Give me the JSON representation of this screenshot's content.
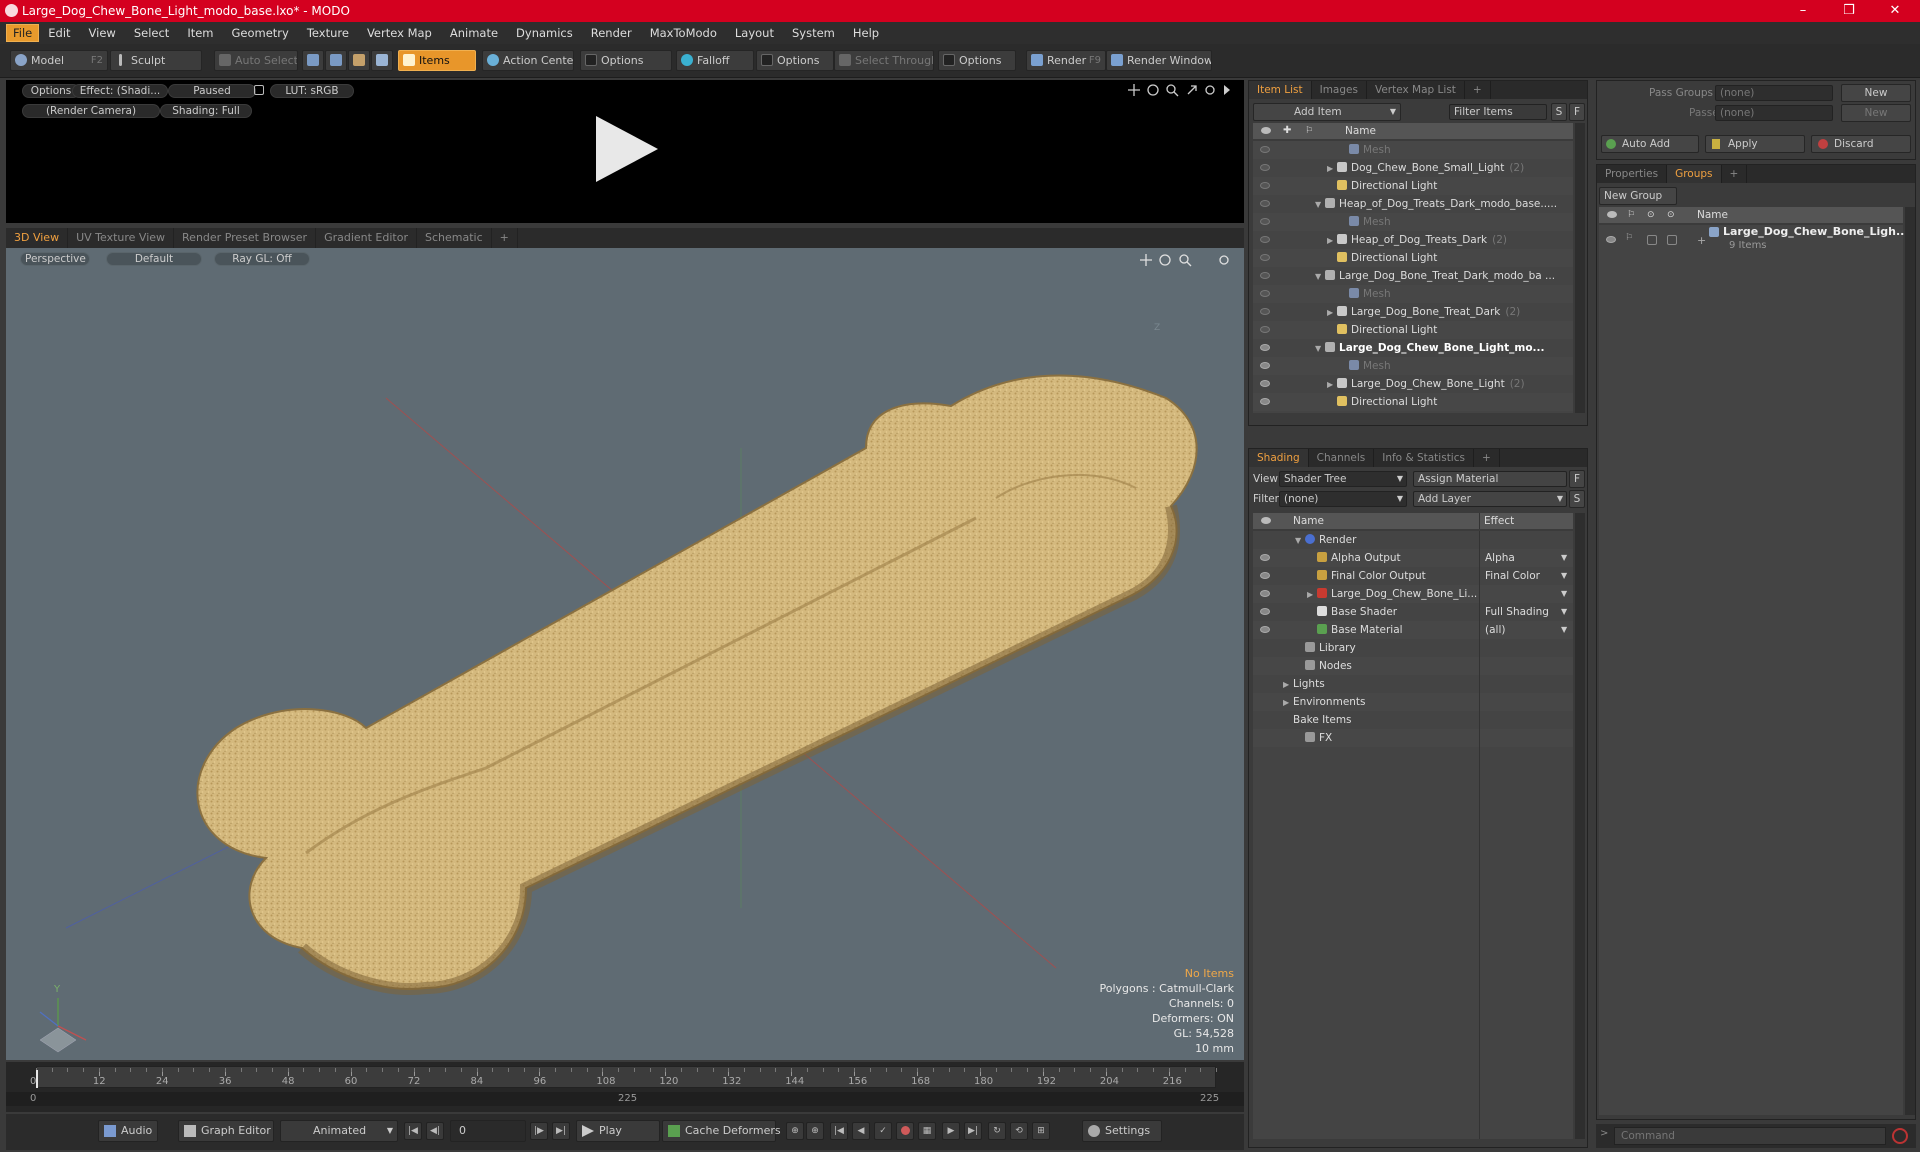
{
  "window": {
    "title": "Large_Dog_Chew_Bone_Light_modo_base.lxo* - MODO",
    "minimize": "–",
    "maximize": "❒",
    "close": "✕"
  },
  "menu": [
    "File",
    "Edit",
    "View",
    "Select",
    "Item",
    "Geometry",
    "Texture",
    "Vertex Map",
    "Animate",
    "Dynamics",
    "Render",
    "MaxToModo",
    "Layout",
    "System",
    "Help"
  ],
  "toolbar": {
    "model": "Model",
    "model_key": "F2",
    "sculpt": "Sculpt",
    "auto_select": "Auto Select",
    "items": "Items",
    "action_center": "Action Center",
    "options1": "Options",
    "falloff": "Falloff",
    "options2": "Options",
    "select_through": "Select Through",
    "options3": "Options",
    "render": "Render",
    "render_key": "F9",
    "render_window": "Render Window"
  },
  "preview": {
    "options": "Options",
    "effect": "Effect: (Shadi...",
    "paused": "Paused",
    "lut": "LUT: sRGB",
    "camera": "(Render Camera)",
    "shading": "Shading: Full"
  },
  "viewport_tabs": [
    "3D View",
    "UV Texture View",
    "Render Preset Browser",
    "Gradient Editor",
    "Schematic",
    "+"
  ],
  "viewport": {
    "perspective": "Perspective",
    "default": "Default",
    "raygl": "Ray GL: Off",
    "axis_z": "Z",
    "axis_y": "Y",
    "axis_x": "X"
  },
  "hud": {
    "items": "No Items",
    "polygons": "Polygons : Catmull-Clark",
    "channels": "Channels: 0",
    "deformers": "Deformers: ON",
    "gl": "GL: 54,528",
    "units": "10 mm"
  },
  "timeline": {
    "ticks": [
      "0",
      "12",
      "24",
      "36",
      "48",
      "60",
      "72",
      "84",
      "96",
      "108",
      "120",
      "132",
      "144",
      "156",
      "168",
      "180",
      "192",
      "204",
      "216"
    ],
    "start": "0",
    "mid": "225",
    "end": "225"
  },
  "bottom": {
    "audio": "Audio",
    "graph_editor": "Graph Editor",
    "animated": "Animated",
    "frame": "0",
    "play": "Play",
    "cache": "Cache Deformers",
    "settings": "Settings"
  },
  "itemlist": {
    "tabs": [
      "Item List",
      "Images",
      "Vertex Map List",
      "+"
    ],
    "add_item": "Add Item",
    "filter": "Filter Items",
    "s": "S",
    "f": "F",
    "col_name": "Name",
    "rows": [
      {
        "label": "Mesh",
        "indent": 3,
        "type": "mesh",
        "expand": "",
        "gray": true,
        "bold": false
      },
      {
        "label": "Dog_Chew_Bone_Small_Light",
        "count": "(2)",
        "indent": 2,
        "type": "group",
        "expand": "▶",
        "gray": false,
        "bold": false
      },
      {
        "label": "Directional Light",
        "indent": 2,
        "type": "light",
        "expand": "",
        "gray": false,
        "bold": false
      },
      {
        "label": "Heap_of_Dog_Treats_Dark_modo_base.....",
        "indent": 1,
        "type": "scene",
        "expand": "▼",
        "gray": false,
        "bold": false
      },
      {
        "label": "Mesh",
        "indent": 3,
        "type": "mesh",
        "expand": "",
        "gray": true,
        "bold": false
      },
      {
        "label": "Heap_of_Dog_Treats_Dark",
        "count": "(2)",
        "indent": 2,
        "type": "group",
        "expand": "▶",
        "gray": false,
        "bold": false
      },
      {
        "label": "Directional Light",
        "indent": 2,
        "type": "light",
        "expand": "",
        "gray": false,
        "bold": false
      },
      {
        "label": "Large_Dog_Bone_Treat_Dark_modo_ba ...",
        "indent": 1,
        "type": "scene",
        "expand": "▼",
        "gray": false,
        "bold": false
      },
      {
        "label": "Mesh",
        "indent": 3,
        "type": "mesh",
        "expand": "",
        "gray": true,
        "bold": false
      },
      {
        "label": "Large_Dog_Bone_Treat_Dark",
        "count": "(2)",
        "indent": 2,
        "type": "group",
        "expand": "▶",
        "gray": false,
        "bold": false
      },
      {
        "label": "Directional Light",
        "indent": 2,
        "type": "light",
        "expand": "",
        "gray": false,
        "bold": false
      },
      {
        "label": "Large_Dog_Chew_Bone_Light_mo...",
        "indent": 1,
        "type": "scene",
        "expand": "▼",
        "gray": false,
        "bold": true
      },
      {
        "label": "Mesh",
        "indent": 3,
        "type": "mesh",
        "expand": "",
        "gray": true,
        "bold": false
      },
      {
        "label": "Large_Dog_Chew_Bone_Light",
        "count": "(2)",
        "indent": 2,
        "type": "group",
        "expand": "▶",
        "gray": false,
        "bold": false
      },
      {
        "label": "Directional Light",
        "indent": 2,
        "type": "light",
        "expand": "",
        "gray": false,
        "bold": false
      }
    ]
  },
  "shading": {
    "tabs": [
      "Shading",
      "Channels",
      "Info & Statistics",
      "+"
    ],
    "view_label": "View",
    "view_value": "Shader Tree",
    "assign": "Assign Material",
    "f": "F",
    "filter_label": "Filter",
    "filter_value": "(none)",
    "add_layer": "Add Layer",
    "s": "S",
    "col_name": "Name",
    "col_effect": "Effect",
    "rows": [
      {
        "label": "Render",
        "effect": "",
        "indent": 1,
        "expand": "▼",
        "icon": "#4a6fd0",
        "eye": false,
        "dd": false
      },
      {
        "label": "Alpha Output",
        "effect": "Alpha",
        "indent": 2,
        "expand": "",
        "icon": "#c8a040",
        "eye": true,
        "dd": true
      },
      {
        "label": "Final Color Output",
        "effect": "Final Color",
        "indent": 2,
        "expand": "",
        "icon": "#c8a040",
        "eye": true,
        "dd": true
      },
      {
        "label": "Large_Dog_Chew_Bone_Li...",
        "effect": "",
        "indent": 2,
        "expand": "▶",
        "icon": "#c83a30",
        "eye": true,
        "dd": true
      },
      {
        "label": "Base Shader",
        "effect": "Full Shading",
        "indent": 2,
        "expand": "",
        "icon": "#dddddd",
        "eye": true,
        "dd": true
      },
      {
        "label": "Base Material",
        "effect": "(all)",
        "indent": 2,
        "expand": "",
        "icon": "#5aa050",
        "eye": true,
        "dd": true
      },
      {
        "label": "Library",
        "effect": "",
        "indent": 1,
        "expand": "",
        "icon": "#999999",
        "eye": false,
        "dd": false
      },
      {
        "label": "Nodes",
        "effect": "",
        "indent": 1,
        "expand": "",
        "icon": "#999999",
        "eye": false,
        "dd": false
      },
      {
        "label": "Lights",
        "effect": "",
        "indent": 0,
        "expand": "▶",
        "icon": "",
        "eye": false,
        "dd": false
      },
      {
        "label": "Environments",
        "effect": "",
        "indent": 0,
        "expand": "▶",
        "icon": "",
        "eye": false,
        "dd": false
      },
      {
        "label": "Bake Items",
        "effect": "",
        "indent": 0,
        "expand": "",
        "icon": "",
        "eye": false,
        "dd": false
      },
      {
        "label": "FX",
        "effect": "",
        "indent": 1,
        "expand": "",
        "icon": "#999999",
        "eye": false,
        "dd": false
      }
    ]
  },
  "pass": {
    "pass_groups": "Pass Groups",
    "passes": "Passes",
    "none1": "(none)",
    "none2": "(none)",
    "new1": "New",
    "new2": "New",
    "auto_add": "Auto Add",
    "apply": "Apply",
    "discard": "Discard"
  },
  "groups": {
    "tabs": [
      "Properties",
      "Groups",
      "+"
    ],
    "new_group": "New Group",
    "col_name": "Name",
    "item": "Large_Dog_Chew_Bone_Ligh...",
    "sub": "9 Items"
  },
  "command": {
    "placeholder": "Command"
  }
}
